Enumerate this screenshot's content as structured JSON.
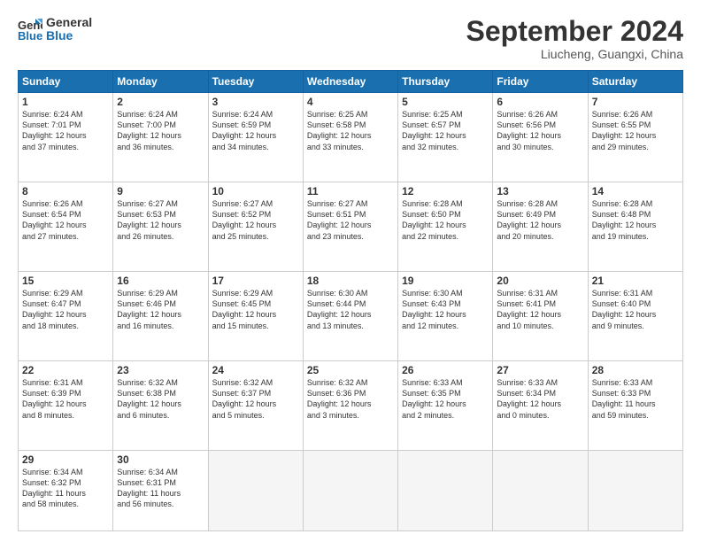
{
  "header": {
    "logo_line1": "General",
    "logo_line2": "Blue",
    "month": "September 2024",
    "location": "Liucheng, Guangxi, China"
  },
  "weekdays": [
    "Sunday",
    "Monday",
    "Tuesday",
    "Wednesday",
    "Thursday",
    "Friday",
    "Saturday"
  ],
  "weeks": [
    [
      {
        "day": "1",
        "lines": [
          "Sunrise: 6:24 AM",
          "Sunset: 7:01 PM",
          "Daylight: 12 hours",
          "and 37 minutes."
        ]
      },
      {
        "day": "2",
        "lines": [
          "Sunrise: 6:24 AM",
          "Sunset: 7:00 PM",
          "Daylight: 12 hours",
          "and 36 minutes."
        ]
      },
      {
        "day": "3",
        "lines": [
          "Sunrise: 6:24 AM",
          "Sunset: 6:59 PM",
          "Daylight: 12 hours",
          "and 34 minutes."
        ]
      },
      {
        "day": "4",
        "lines": [
          "Sunrise: 6:25 AM",
          "Sunset: 6:58 PM",
          "Daylight: 12 hours",
          "and 33 minutes."
        ]
      },
      {
        "day": "5",
        "lines": [
          "Sunrise: 6:25 AM",
          "Sunset: 6:57 PM",
          "Daylight: 12 hours",
          "and 32 minutes."
        ]
      },
      {
        "day": "6",
        "lines": [
          "Sunrise: 6:26 AM",
          "Sunset: 6:56 PM",
          "Daylight: 12 hours",
          "and 30 minutes."
        ]
      },
      {
        "day": "7",
        "lines": [
          "Sunrise: 6:26 AM",
          "Sunset: 6:55 PM",
          "Daylight: 12 hours",
          "and 29 minutes."
        ]
      }
    ],
    [
      {
        "day": "8",
        "lines": [
          "Sunrise: 6:26 AM",
          "Sunset: 6:54 PM",
          "Daylight: 12 hours",
          "and 27 minutes."
        ]
      },
      {
        "day": "9",
        "lines": [
          "Sunrise: 6:27 AM",
          "Sunset: 6:53 PM",
          "Daylight: 12 hours",
          "and 26 minutes."
        ]
      },
      {
        "day": "10",
        "lines": [
          "Sunrise: 6:27 AM",
          "Sunset: 6:52 PM",
          "Daylight: 12 hours",
          "and 25 minutes."
        ]
      },
      {
        "day": "11",
        "lines": [
          "Sunrise: 6:27 AM",
          "Sunset: 6:51 PM",
          "Daylight: 12 hours",
          "and 23 minutes."
        ]
      },
      {
        "day": "12",
        "lines": [
          "Sunrise: 6:28 AM",
          "Sunset: 6:50 PM",
          "Daylight: 12 hours",
          "and 22 minutes."
        ]
      },
      {
        "day": "13",
        "lines": [
          "Sunrise: 6:28 AM",
          "Sunset: 6:49 PM",
          "Daylight: 12 hours",
          "and 20 minutes."
        ]
      },
      {
        "day": "14",
        "lines": [
          "Sunrise: 6:28 AM",
          "Sunset: 6:48 PM",
          "Daylight: 12 hours",
          "and 19 minutes."
        ]
      }
    ],
    [
      {
        "day": "15",
        "lines": [
          "Sunrise: 6:29 AM",
          "Sunset: 6:47 PM",
          "Daylight: 12 hours",
          "and 18 minutes."
        ]
      },
      {
        "day": "16",
        "lines": [
          "Sunrise: 6:29 AM",
          "Sunset: 6:46 PM",
          "Daylight: 12 hours",
          "and 16 minutes."
        ]
      },
      {
        "day": "17",
        "lines": [
          "Sunrise: 6:29 AM",
          "Sunset: 6:45 PM",
          "Daylight: 12 hours",
          "and 15 minutes."
        ]
      },
      {
        "day": "18",
        "lines": [
          "Sunrise: 6:30 AM",
          "Sunset: 6:44 PM",
          "Daylight: 12 hours",
          "and 13 minutes."
        ]
      },
      {
        "day": "19",
        "lines": [
          "Sunrise: 6:30 AM",
          "Sunset: 6:43 PM",
          "Daylight: 12 hours",
          "and 12 minutes."
        ]
      },
      {
        "day": "20",
        "lines": [
          "Sunrise: 6:31 AM",
          "Sunset: 6:41 PM",
          "Daylight: 12 hours",
          "and 10 minutes."
        ]
      },
      {
        "day": "21",
        "lines": [
          "Sunrise: 6:31 AM",
          "Sunset: 6:40 PM",
          "Daylight: 12 hours",
          "and 9 minutes."
        ]
      }
    ],
    [
      {
        "day": "22",
        "lines": [
          "Sunrise: 6:31 AM",
          "Sunset: 6:39 PM",
          "Daylight: 12 hours",
          "and 8 minutes."
        ]
      },
      {
        "day": "23",
        "lines": [
          "Sunrise: 6:32 AM",
          "Sunset: 6:38 PM",
          "Daylight: 12 hours",
          "and 6 minutes."
        ]
      },
      {
        "day": "24",
        "lines": [
          "Sunrise: 6:32 AM",
          "Sunset: 6:37 PM",
          "Daylight: 12 hours",
          "and 5 minutes."
        ]
      },
      {
        "day": "25",
        "lines": [
          "Sunrise: 6:32 AM",
          "Sunset: 6:36 PM",
          "Daylight: 12 hours",
          "and 3 minutes."
        ]
      },
      {
        "day": "26",
        "lines": [
          "Sunrise: 6:33 AM",
          "Sunset: 6:35 PM",
          "Daylight: 12 hours",
          "and 2 minutes."
        ]
      },
      {
        "day": "27",
        "lines": [
          "Sunrise: 6:33 AM",
          "Sunset: 6:34 PM",
          "Daylight: 12 hours",
          "and 0 minutes."
        ]
      },
      {
        "day": "28",
        "lines": [
          "Sunrise: 6:33 AM",
          "Sunset: 6:33 PM",
          "Daylight: 11 hours",
          "and 59 minutes."
        ]
      }
    ],
    [
      {
        "day": "29",
        "lines": [
          "Sunrise: 6:34 AM",
          "Sunset: 6:32 PM",
          "Daylight: 11 hours",
          "and 58 minutes."
        ]
      },
      {
        "day": "30",
        "lines": [
          "Sunrise: 6:34 AM",
          "Sunset: 6:31 PM",
          "Daylight: 11 hours",
          "and 56 minutes."
        ]
      },
      {
        "day": "",
        "lines": []
      },
      {
        "day": "",
        "lines": []
      },
      {
        "day": "",
        "lines": []
      },
      {
        "day": "",
        "lines": []
      },
      {
        "day": "",
        "lines": []
      }
    ]
  ]
}
